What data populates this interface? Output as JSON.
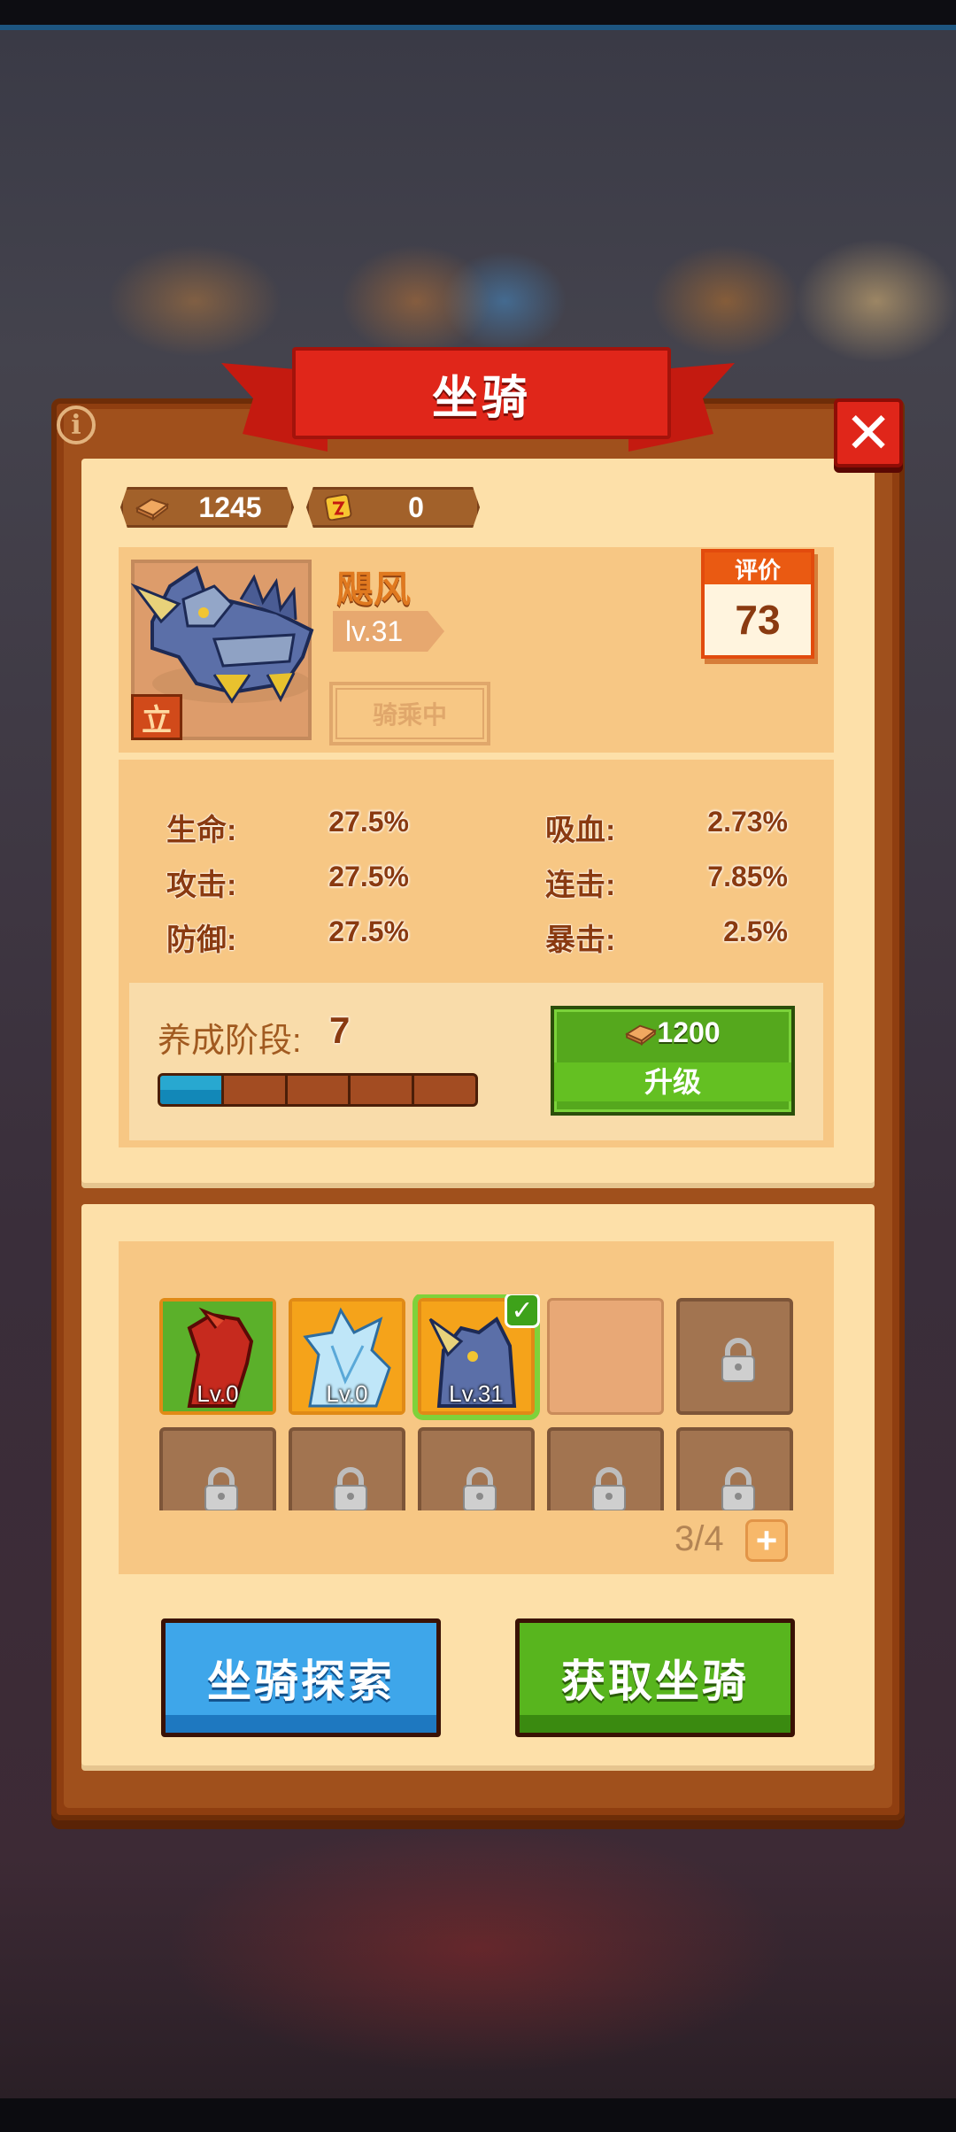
{
  "title": "坐骑",
  "currency": {
    "parts": "1245",
    "tickets": "0"
  },
  "mount": {
    "name": "飓风",
    "level": "lv.31",
    "status_button": "骑乘中",
    "rating_label": "评价",
    "rating_value": "73"
  },
  "stats": [
    {
      "label": "生命:",
      "value": "27.5%"
    },
    {
      "label": "吸血:",
      "value": "2.73%"
    },
    {
      "label": "攻击:",
      "value": "27.5%"
    },
    {
      "label": "连击:",
      "value": "7.85%"
    },
    {
      "label": "防御:",
      "value": "27.5%"
    },
    {
      "label": "暴击:",
      "value": "2.5%"
    }
  ],
  "cultivation": {
    "label": "养成阶段:",
    "value": "7",
    "progress_segments": 5,
    "progress_filled": 1
  },
  "upgrade": {
    "cost": "1200",
    "label": "升级"
  },
  "slots": [
    {
      "type": "mount",
      "name": "red-horse",
      "level": "Lv.0"
    },
    {
      "type": "mount",
      "name": "ice-crystal",
      "level": "Lv.0"
    },
    {
      "type": "mount",
      "name": "armored-rhino",
      "level": "Lv.31",
      "selected": true
    },
    {
      "type": "empty"
    },
    {
      "type": "locked"
    },
    {
      "type": "locked"
    },
    {
      "type": "locked"
    },
    {
      "type": "locked"
    },
    {
      "type": "locked"
    },
    {
      "type": "locked"
    }
  ],
  "slot_count": "3/4",
  "buttons": {
    "explore": "坐骑探索",
    "obtain": "获取坐骑"
  },
  "colors": {
    "accent_red": "#e0261a",
    "panel": "#fde0a9",
    "frame": "#8f3e10",
    "green": "#55a81d",
    "blue": "#3ea6ea"
  }
}
